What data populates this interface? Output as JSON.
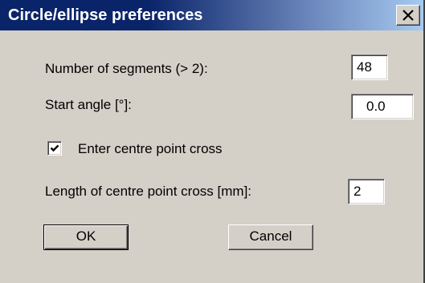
{
  "window": {
    "title": "Circle/ellipse preferences",
    "close_icon": "close-x-icon"
  },
  "segments": {
    "label": "Number of segments (> 2):",
    "value": "48"
  },
  "start_angle": {
    "label": "Start angle [°]:",
    "value": "0.0"
  },
  "centre_point_cross": {
    "label": "Enter centre point cross",
    "checked": true
  },
  "cross_length": {
    "label": "Length of centre point cross [mm]:",
    "value": "2"
  },
  "buttons": {
    "ok_label": "OK",
    "cancel_label": "Cancel"
  },
  "colors": {
    "titlebar_start": "#0a246a",
    "titlebar_end": "#a6caf0",
    "dialog_bg": "#d4d0c8"
  }
}
